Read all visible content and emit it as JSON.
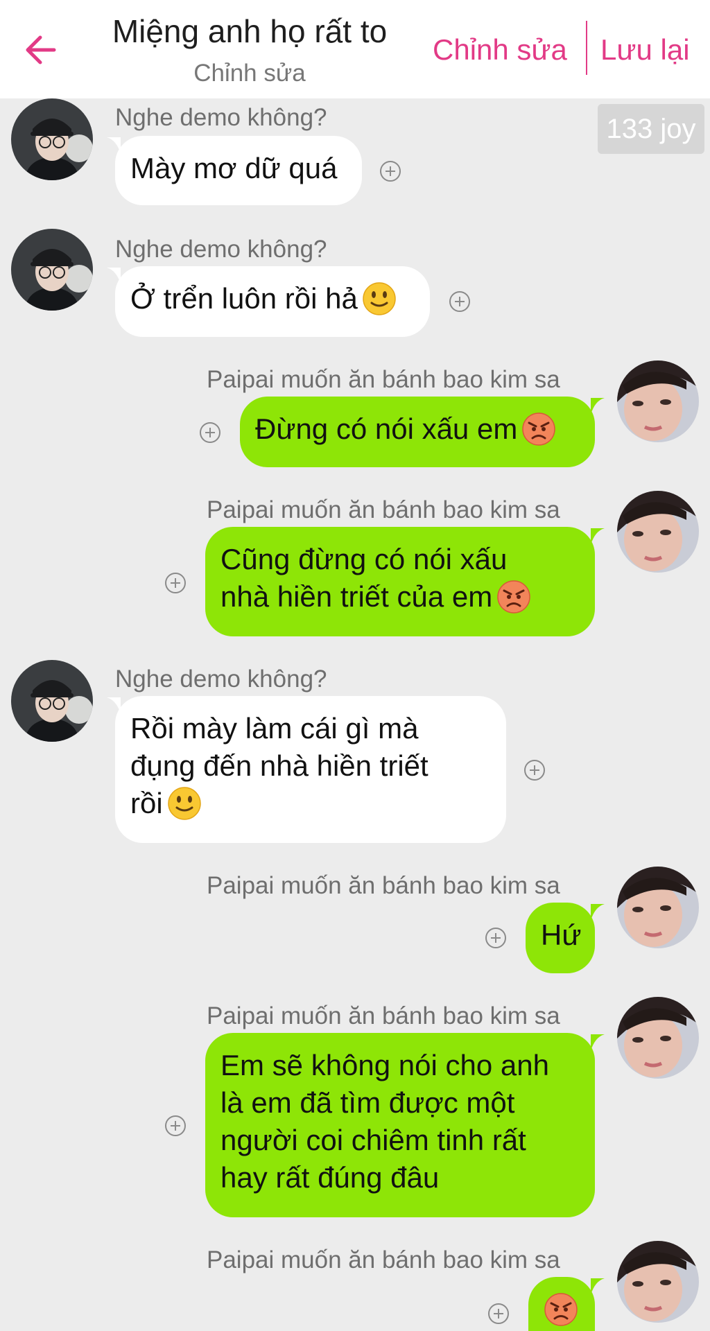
{
  "header": {
    "title": "Miệng anh họ rất to",
    "subtitle": "Chỉnh sửa",
    "edit_label": "Chỉnh sửa",
    "save_label": "Lưu lại",
    "accent_color": "#e23a86"
  },
  "badge": {
    "text": "133 joy"
  },
  "messages": [
    {
      "side": "in",
      "sender": "Nghe demo không?",
      "lines": [
        "Mày mơ dữ quá"
      ],
      "emoji": ""
    },
    {
      "side": "in",
      "sender": "Nghe demo không?",
      "lines": [
        "Ở trển luôn rồi hả"
      ],
      "emoji": "slightly-smiling-face"
    },
    {
      "side": "out",
      "sender": "Paipai muốn ăn bánh bao kim sa",
      "lines": [
        "Đừng có nói xấu em"
      ],
      "emoji": "angry-face"
    },
    {
      "side": "out",
      "sender": "Paipai muốn ăn bánh bao kim sa",
      "lines": [
        "Cũng đừng có nói xấu",
        "nhà hiền triết của em"
      ],
      "emoji": "angry-face"
    },
    {
      "side": "in",
      "sender": "Nghe demo không?",
      "lines": [
        "Rồi mày làm cái gì mà",
        "đụng đến nhà hiền triết",
        "rồi"
      ],
      "emoji": "slightly-smiling-face"
    },
    {
      "side": "out",
      "sender": "Paipai muốn ăn bánh bao kim sa",
      "lines": [
        "Hứ"
      ],
      "emoji": ""
    },
    {
      "side": "out",
      "sender": "Paipai muốn ăn bánh bao kim sa",
      "lines": [
        "Em sẽ không nói cho anh",
        "là em đã tìm được một",
        "người coi chiêm tinh rất",
        "hay rất đúng đâu"
      ],
      "emoji": ""
    },
    {
      "side": "out",
      "sender": "Paipai muốn ăn bánh bao kim sa",
      "lines": [
        ""
      ],
      "emoji": "angry-face"
    }
  ],
  "colors": {
    "incoming_bubble": "#ffffff",
    "outgoing_bubble": "#8ee507",
    "background": "#ececec"
  }
}
